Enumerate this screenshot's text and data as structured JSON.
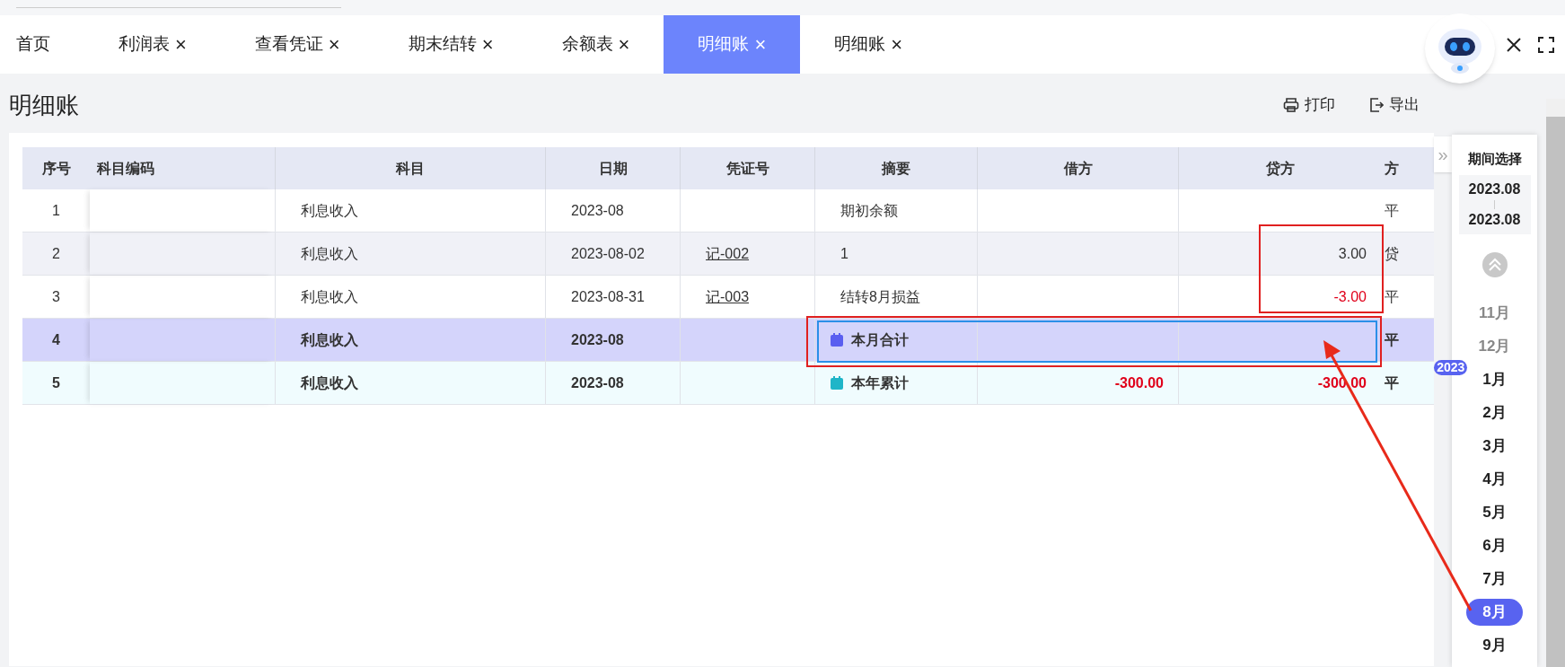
{
  "tabs": [
    {
      "label": "首页",
      "closable": false,
      "selected": false
    },
    {
      "label": "利润表",
      "closable": true,
      "selected": false
    },
    {
      "label": "查看凭证",
      "closable": true,
      "selected": false
    },
    {
      "label": "期末结转",
      "closable": true,
      "selected": false
    },
    {
      "label": "余额表",
      "closable": true,
      "selected": false
    },
    {
      "label": "明细账",
      "closable": true,
      "selected": true
    },
    {
      "label": "明细账",
      "closable": true,
      "selected": false
    }
  ],
  "close_glyph": "×",
  "page_title": "明细账",
  "toolbar": [
    {
      "kind": "print",
      "label": "打印"
    },
    {
      "kind": "export",
      "label": "导出"
    }
  ],
  "table": {
    "columns": [
      "序号",
      "科目编码",
      "科目",
      "日期",
      "凭证号",
      "摘要",
      "借方",
      "贷方",
      "方"
    ],
    "rows": [
      {
        "kind": "entry",
        "selected": false,
        "seq": "1",
        "account": "利息收入",
        "date": "2023-08",
        "summary": "期初余额",
        "direction": "平"
      },
      {
        "kind": "entry",
        "selected": false,
        "seq": "2",
        "account": "利息收入",
        "date": "2023-08-02",
        "voucher": "记-002",
        "summary": "1",
        "credit": {
          "text": "3.00",
          "negative": false
        },
        "direction": "贷"
      },
      {
        "kind": "entry",
        "selected": false,
        "seq": "3",
        "account": "利息收入",
        "date": "2023-08-31",
        "voucher": "记-003",
        "summary": "结转8月损益",
        "credit": {
          "text": "-3.00",
          "negative": true
        },
        "direction": "平"
      },
      {
        "kind": "month_total",
        "selected": true,
        "seq": "4",
        "account": "利息收入",
        "date": "2023-08",
        "summary": "本月合计",
        "direction": "平"
      },
      {
        "kind": "year_total",
        "selected": false,
        "seq": "5",
        "account": "利息收入",
        "date": "2023-08",
        "summary": "本年累计",
        "debit": {
          "text": "-300.00",
          "negative": true
        },
        "credit": {
          "text": "-300.00",
          "negative": true
        },
        "direction": "平"
      }
    ]
  },
  "period_panel": {
    "expand_glyph": "»",
    "title": "期间选择",
    "start": "2023.08",
    "end": "2023.08",
    "months": [
      {
        "label": "11月",
        "selected": false
      },
      {
        "label": "12月",
        "selected": false
      },
      {
        "label": "1月",
        "year": "2023",
        "selected": false
      },
      {
        "label": "2月",
        "selected": false
      },
      {
        "label": "3月",
        "selected": false
      },
      {
        "label": "4月",
        "selected": false
      },
      {
        "label": "5月",
        "selected": false
      },
      {
        "label": "6月",
        "selected": false
      },
      {
        "label": "7月",
        "selected": false
      },
      {
        "label": "8月",
        "selected": true
      },
      {
        "label": "9月",
        "selected": false
      }
    ]
  }
}
